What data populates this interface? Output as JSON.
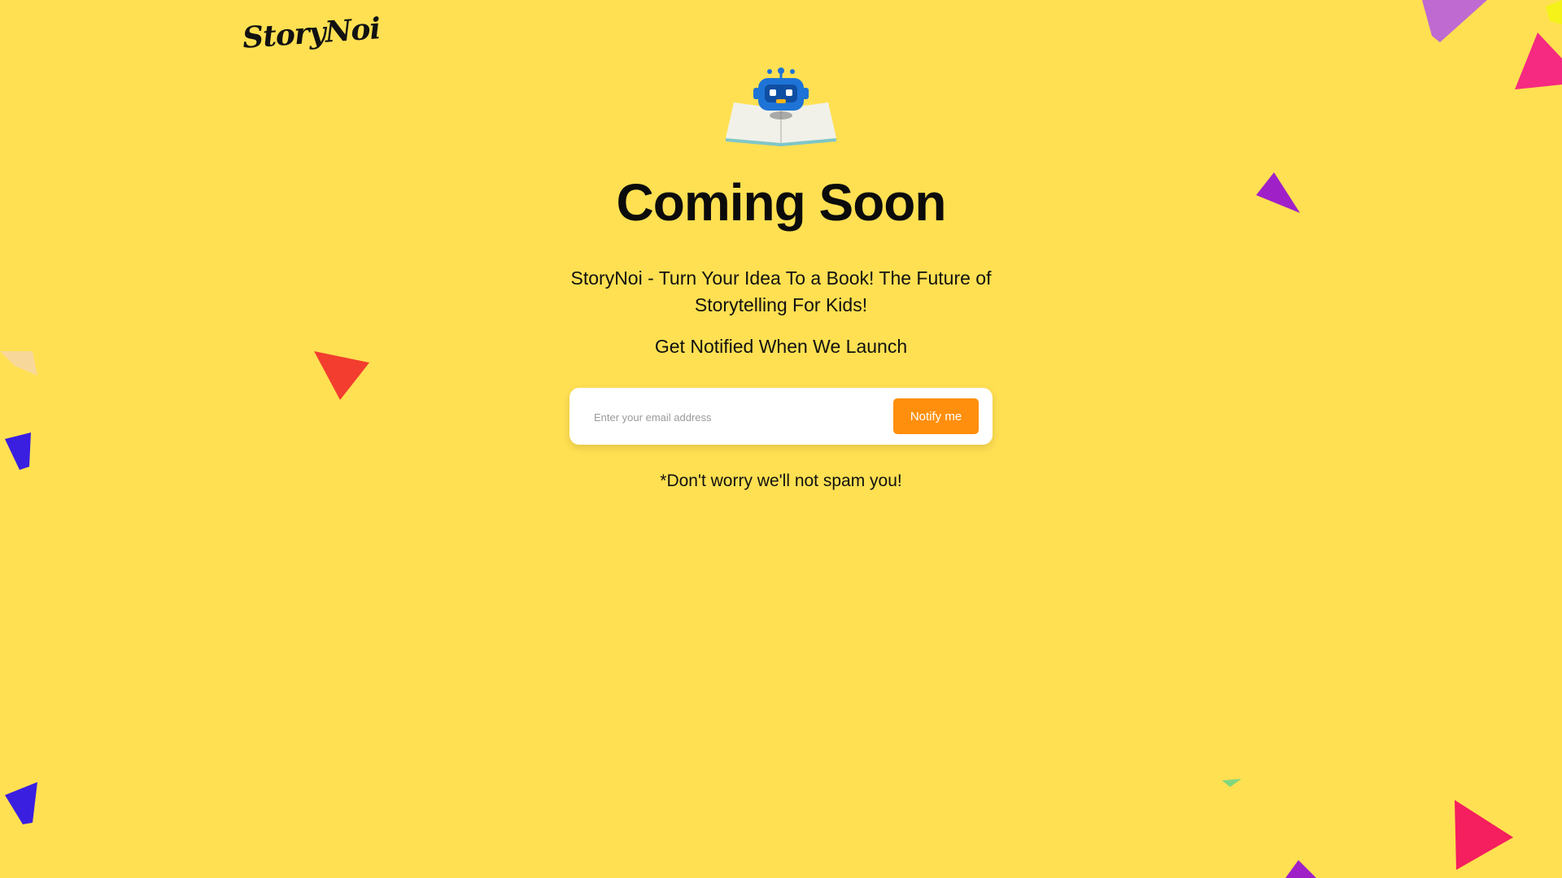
{
  "brand": {
    "logo_text": "StoryNoi"
  },
  "hero": {
    "icon": "robot-reading-book-icon",
    "title": "Coming Soon",
    "tagline": "StoryNoi - Turn Your Idea To a Book! The Future of Storytelling For Kids!",
    "subtitle": "Get Notified When We Launch"
  },
  "signup": {
    "email_placeholder": "Enter your email address",
    "email_value": "",
    "button_label": "Notify me"
  },
  "footnote": "*Don't worry we'll not spam you!",
  "colors": {
    "background": "#ffe052",
    "button": "#ff8f0c",
    "card": "#ffffff",
    "text": "#111111"
  }
}
